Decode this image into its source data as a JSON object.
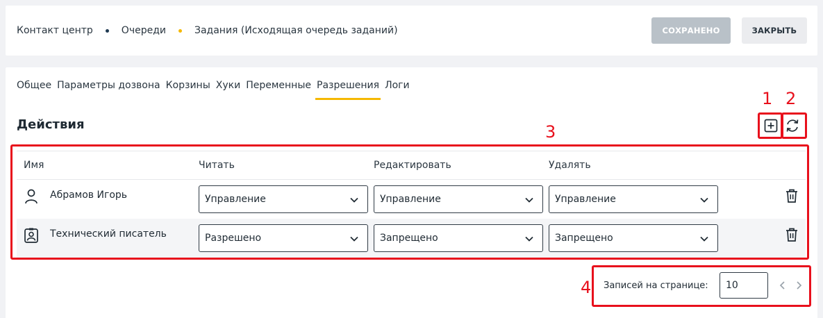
{
  "breadcrumb": [
    {
      "label": "Контакт центр",
      "dot_color": "#1f3a52"
    },
    {
      "label": "Очереди",
      "dot_color": "#f5b800"
    },
    {
      "label": "Задания (Исходящая очередь заданий)",
      "dot_color": null
    }
  ],
  "header": {
    "saved_label": "СОХРАНЕНО",
    "close_label": "ЗАКРЫТЬ"
  },
  "tabs": [
    {
      "label": "Общее",
      "active": false
    },
    {
      "label": "Параметры дозвона",
      "active": false
    },
    {
      "label": "Корзины",
      "active": false
    },
    {
      "label": "Хуки",
      "active": false
    },
    {
      "label": "Переменные",
      "active": false
    },
    {
      "label": "Разрешения",
      "active": true
    },
    {
      "label": "Логи",
      "active": false
    }
  ],
  "section": {
    "title": "Действия",
    "add_icon": "plus-square-icon",
    "refresh_icon": "refresh-icon"
  },
  "table": {
    "columns": [
      "Имя",
      "Читать",
      "Редактировать",
      "Удалять"
    ],
    "rows": [
      {
        "icon": "person-icon",
        "name": "Абрамов Игорь",
        "read": "Управление",
        "edit": "Управление",
        "delete": "Управление"
      },
      {
        "icon": "badge-icon",
        "name": "Технический писатель",
        "read": "Разрешено",
        "edit": "Запрещено",
        "delete": "Запрещено"
      }
    ]
  },
  "pagination": {
    "label": "Записей на странице:",
    "per_page": "10"
  },
  "annotations": [
    "1",
    "2",
    "3",
    "4"
  ],
  "colors": {
    "accent": "#f5b800",
    "annotation": "#e8101c",
    "saved_button": "#b9c1c8"
  }
}
